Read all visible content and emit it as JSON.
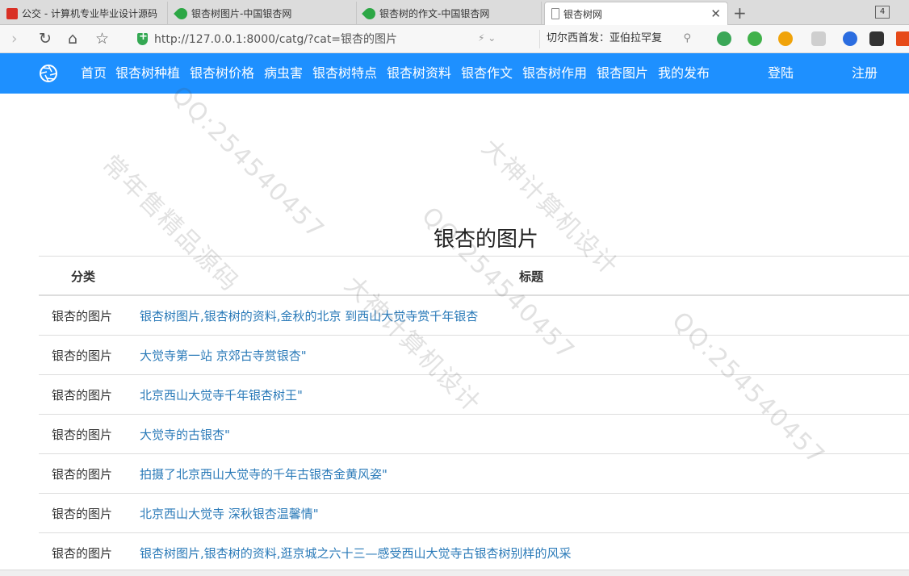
{
  "browser": {
    "tabs": [
      {
        "label": "公交 - 计算机专业毕业设计源码",
        "icon": "red-square-icon",
        "active": false
      },
      {
        "label": "银杏树图片-中国银杏网",
        "icon": "ginkgo-leaf-icon",
        "active": false
      },
      {
        "label": "银杏树的作文-中国银杏网",
        "icon": "ginkgo-leaf-icon",
        "active": false
      },
      {
        "label": "银杏树网",
        "icon": "page-icon",
        "active": true
      }
    ],
    "tab_count": "4",
    "url": "http://127.0.0.1:8000/catg/?cat=银杏的图片",
    "search_text": "切尔西首发：亚伯拉罕复"
  },
  "nav": {
    "items": [
      "首页",
      "银杏树种植",
      "银杏树价格",
      "病虫害",
      "银杏树特点",
      "银杏树资料",
      "银杏作文",
      "银杏树作用",
      "银杏图片",
      "我的发布"
    ],
    "login": "登陆",
    "register": "注册",
    "bar_color": "#1e90ff"
  },
  "page": {
    "title": "银杏的图片",
    "columns": {
      "category": "分类",
      "title": "标题"
    },
    "rows": [
      {
        "category": "银杏的图片",
        "title": "银杏树图片,银杏树的资料,金秋的北京 到西山大觉寺赏千年银杏"
      },
      {
        "category": "银杏的图片",
        "title": "大觉寺第一站 京郊古寺赏银杏\""
      },
      {
        "category": "银杏的图片",
        "title": "北京西山大觉寺千年银杏树王\""
      },
      {
        "category": "银杏的图片",
        "title": "大觉寺的古银杏\""
      },
      {
        "category": "银杏的图片",
        "title": "拍摄了北京西山大觉寺的千年古银杏金黄风姿\""
      },
      {
        "category": "银杏的图片",
        "title": "北京西山大觉寺 深秋银杏温馨情\""
      },
      {
        "category": "银杏的图片",
        "title": "银杏树图片,银杏树的资料,逛京城之六十三—感受西山大觉寺古银杏树别样的风采"
      }
    ],
    "link_color": "#2a7ab8"
  },
  "watermark": {
    "texts": [
      "QQ:254540457",
      "常年售精品源码",
      "大神计算机设计"
    ]
  }
}
